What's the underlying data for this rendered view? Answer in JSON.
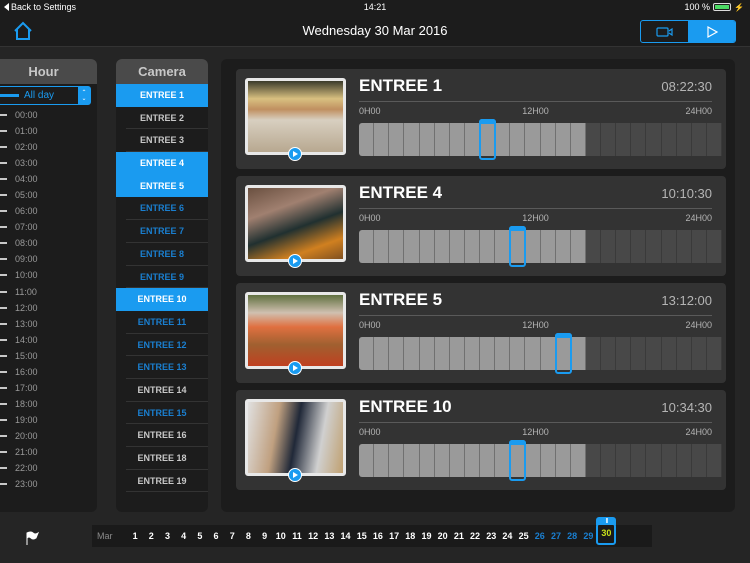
{
  "statusbar": {
    "back_label": "Back to Settings",
    "clock": "14:21",
    "battery": "100 %"
  },
  "navbar": {
    "title": "Wednesday 30 Mar 2016",
    "segments": [
      {
        "icon": "video-camera-icon",
        "active": false
      },
      {
        "icon": "play-icon",
        "active": true
      }
    ]
  },
  "hour_panel": {
    "title": "Hour",
    "selected": "All day",
    "hours": [
      "00:00",
      "01:00",
      "02:00",
      "03:00",
      "04:00",
      "05:00",
      "06:00",
      "07:00",
      "08:00",
      "09:00",
      "10:00",
      "11:00",
      "12:00",
      "13:00",
      "14:00",
      "15:00",
      "16:00",
      "17:00",
      "18:00",
      "19:00",
      "20:00",
      "21:00",
      "22:00",
      "23:00"
    ]
  },
  "camera_panel": {
    "title": "Camera",
    "cameras": [
      {
        "label": "ENTREE 1",
        "state": "selected"
      },
      {
        "label": "ENTREE 2",
        "state": "normal"
      },
      {
        "label": "ENTREE 3",
        "state": "normal"
      },
      {
        "label": "ENTREE 4",
        "state": "selected"
      },
      {
        "label": "ENTREE 5",
        "state": "selected"
      },
      {
        "label": "ENTREE 6",
        "state": "recorded"
      },
      {
        "label": "ENTREE 7",
        "state": "recorded"
      },
      {
        "label": "ENTREE 8",
        "state": "recorded"
      },
      {
        "label": "ENTREE 9",
        "state": "recorded"
      },
      {
        "label": "ENTREE 10",
        "state": "selected"
      },
      {
        "label": "ENTREE 11",
        "state": "recorded"
      },
      {
        "label": "ENTREE 12",
        "state": "recorded"
      },
      {
        "label": "ENTREE 13",
        "state": "recorded"
      },
      {
        "label": "ENTREE 14",
        "state": "normal"
      },
      {
        "label": "ENTREE 15",
        "state": "recorded"
      },
      {
        "label": "ENTREE 16",
        "state": "normal"
      },
      {
        "label": "ENTREE 18",
        "state": "normal"
      },
      {
        "label": "ENTREE 19",
        "state": "normal"
      }
    ]
  },
  "timeline_axis": {
    "start": "0H00",
    "mid": "12H00",
    "end": "24H00"
  },
  "feeds": [
    {
      "name": "ENTREE 1",
      "time": "08:22:30",
      "cursor_hour": 8.375,
      "recorded_hours": 15,
      "scene": "bakery"
    },
    {
      "name": "ENTREE 4",
      "time": "10:10:30",
      "cursor_hour": 10.175,
      "recorded_hours": 15,
      "scene": "checkout"
    },
    {
      "name": "ENTREE 5",
      "time": "13:12:00",
      "cursor_hour": 13.2,
      "recorded_hours": 15,
      "scene": "produce"
    },
    {
      "name": "ENTREE 10",
      "time": "10:34:30",
      "cursor_hour": 10.575,
      "recorded_hours": 15,
      "scene": "entrance"
    }
  ],
  "datebar": {
    "month": "Mar",
    "days": [
      {
        "d": "1",
        "s": "normal"
      },
      {
        "d": "2",
        "s": "normal"
      },
      {
        "d": "3",
        "s": "normal"
      },
      {
        "d": "4",
        "s": "normal"
      },
      {
        "d": "5",
        "s": "normal"
      },
      {
        "d": "6",
        "s": "normal"
      },
      {
        "d": "7",
        "s": "normal"
      },
      {
        "d": "8",
        "s": "normal"
      },
      {
        "d": "9",
        "s": "normal"
      },
      {
        "d": "10",
        "s": "normal"
      },
      {
        "d": "11",
        "s": "normal"
      },
      {
        "d": "12",
        "s": "normal"
      },
      {
        "d": "13",
        "s": "normal"
      },
      {
        "d": "14",
        "s": "normal"
      },
      {
        "d": "15",
        "s": "normal"
      },
      {
        "d": "16",
        "s": "normal"
      },
      {
        "d": "17",
        "s": "normal"
      },
      {
        "d": "18",
        "s": "normal"
      },
      {
        "d": "19",
        "s": "normal"
      },
      {
        "d": "20",
        "s": "normal"
      },
      {
        "d": "21",
        "s": "normal"
      },
      {
        "d": "22",
        "s": "normal"
      },
      {
        "d": "23",
        "s": "normal"
      },
      {
        "d": "24",
        "s": "normal"
      },
      {
        "d": "25",
        "s": "normal"
      },
      {
        "d": "26",
        "s": "recorded"
      },
      {
        "d": "27",
        "s": "recorded"
      },
      {
        "d": "28",
        "s": "recorded"
      },
      {
        "d": "29",
        "s": "recorded"
      },
      {
        "d": "30",
        "s": "selected"
      }
    ]
  },
  "colors": {
    "accent": "#1a9bf0",
    "recorded_text": "#1a7fd0",
    "selected_day": "#c8e01a"
  }
}
